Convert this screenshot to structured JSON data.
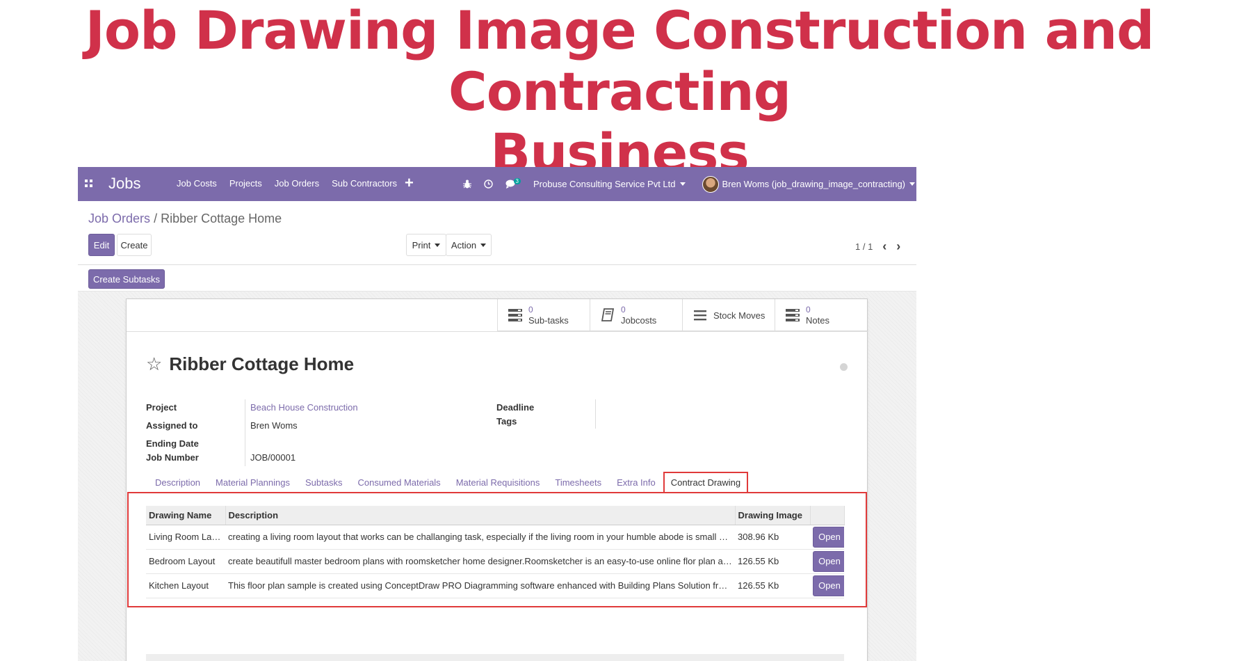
{
  "hero": {
    "title_line1": "Job Drawing Image Construction and Contracting",
    "title_line2": "Business"
  },
  "navbar": {
    "app_name": "Jobs",
    "menu": [
      "Job Costs",
      "Projects",
      "Job Orders",
      "Sub Contractors"
    ],
    "chat_count": "3",
    "company": "Probuse Consulting Service Pvt Ltd",
    "user": "Bren Woms (job_drawing_image_contracting)"
  },
  "breadcrumb": {
    "parent": "Job Orders",
    "separator": "/",
    "current": "Ribber Cottage Home"
  },
  "controls": {
    "edit": "Edit",
    "create": "Create",
    "print": "Print",
    "action": "Action",
    "pager": "1 / 1",
    "create_subtasks": "Create Subtasks"
  },
  "smart_buttons": [
    {
      "count": "0",
      "label": "Sub-tasks",
      "icon": "tasks-icon"
    },
    {
      "count": "0",
      "label": "Jobcosts",
      "icon": "book-icon"
    },
    {
      "count": "",
      "label": "Stock Moves",
      "icon": "bars-icon"
    },
    {
      "count": "0",
      "label": "Notes",
      "icon": "tasks-icon"
    }
  ],
  "record": {
    "title": "Ribber Cottage Home",
    "fields": {
      "project_label": "Project",
      "project_value": "Beach House Construction",
      "assigned_label": "Assigned to",
      "assigned_value": "Bren Woms",
      "ending_label": "Ending Date",
      "job_number_label": "Job Number",
      "job_number_value": "JOB/00001",
      "deadline_label": "Deadline",
      "tags_label": "Tags"
    }
  },
  "tabs": [
    "Description",
    "Material Plannings",
    "Subtasks",
    "Consumed Materials",
    "Material Requisitions",
    "Timesheets",
    "Extra Info",
    "Contract Drawing"
  ],
  "active_tab": "Contract Drawing",
  "drawings": {
    "headers": [
      "Drawing Name",
      "Description",
      "Drawing Image",
      ""
    ],
    "rows": [
      {
        "name": "Living Room Layout",
        "description": "creating a living room layout that works can be challanging task, especially if the living room in your humble abode is small or narrow…",
        "size": "308.96 Kb",
        "button": "Open"
      },
      {
        "name": "Bedroom Layout",
        "description": "create beautifull master bedroom plans with roomsketcher home designer.Roomsketcher is an easy-to-use online flor plan and hom…",
        "size": "126.55 Kb",
        "button": "Open"
      },
      {
        "name": "Kitchen Layout",
        "description": "This floor plan sample is created using ConceptDraw PRO Diagramming software enhanced with Building Plans Solution from Conc…",
        "size": "126.55 Kb",
        "button": "Open"
      }
    ]
  },
  "colors": {
    "brand": "#7c6bab",
    "hero": "#d0314a",
    "highlight": "#e03a3a"
  }
}
